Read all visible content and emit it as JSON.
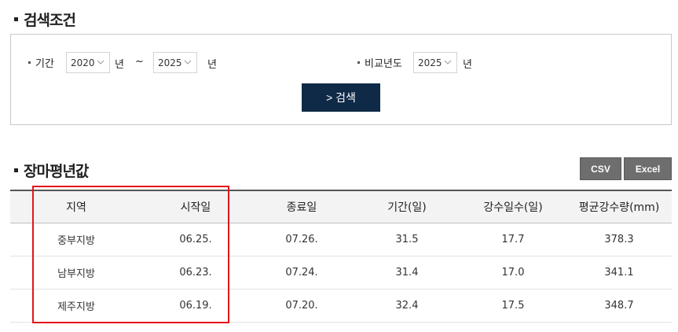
{
  "search": {
    "title": "검색조건",
    "period_label": "기간",
    "from_year": "2020",
    "to_year": "2025",
    "year_unit": "년",
    "tilde": "~",
    "compare_label": "비교년도",
    "compare_year": "2025",
    "search_button": "> 검색"
  },
  "result": {
    "title": "장마평년값",
    "csv_button": "CSV",
    "excel_button": "Excel",
    "columns": [
      "지역",
      "시작일",
      "종료일",
      "기간(일)",
      "강수일수(일)",
      "평균강수량(mm)"
    ],
    "rows": [
      [
        "중부지방",
        "06.25.",
        "07.26.",
        "31.5",
        "17.7",
        "378.3"
      ],
      [
        "남부지방",
        "06.23.",
        "07.24.",
        "31.4",
        "17.0",
        "341.1"
      ],
      [
        "제주지방",
        "06.19.",
        "07.20.",
        "32.4",
        "17.5",
        "348.7"
      ]
    ]
  },
  "colors": {
    "button_primary": "#0f2a47",
    "button_export": "#6e6e6e",
    "highlight": "#e2141b"
  }
}
